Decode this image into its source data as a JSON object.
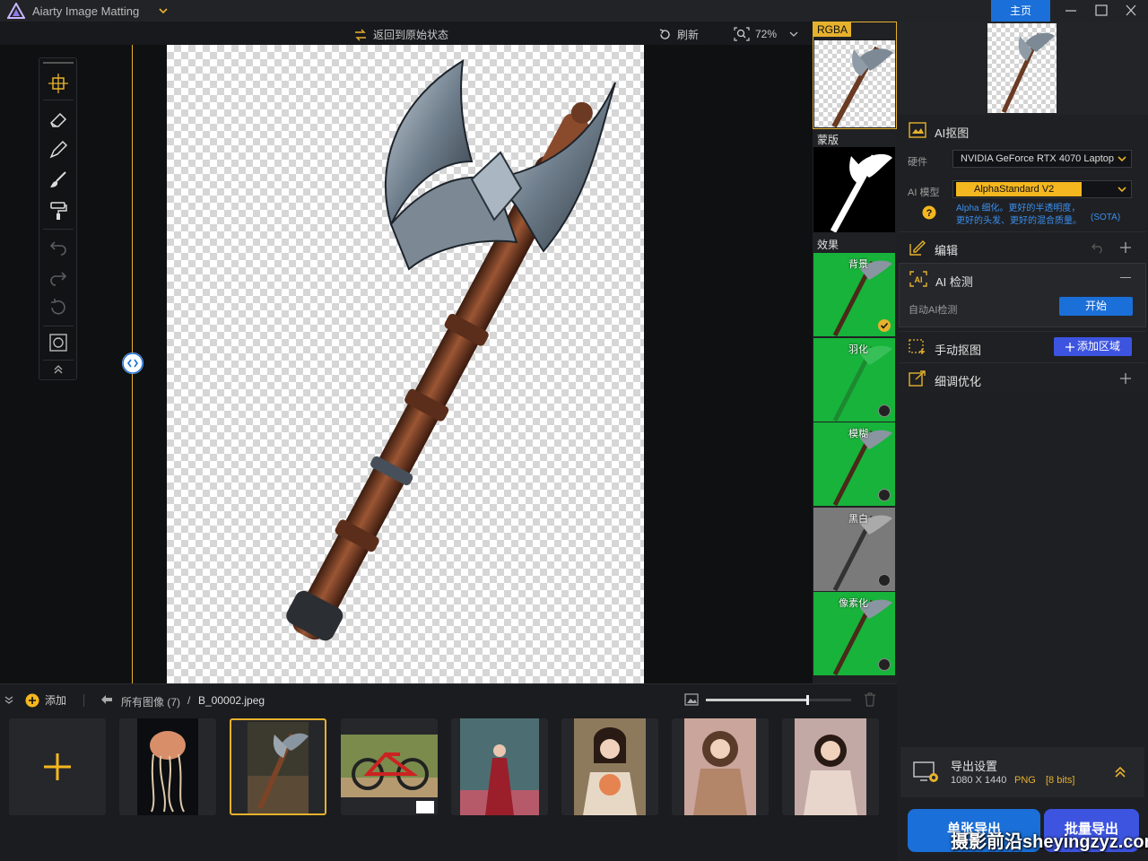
{
  "app": {
    "title": "Aiarty Image Matting",
    "home_tab": "主页"
  },
  "toolbar": {
    "reset_label": "返回到原始状态",
    "refresh_label": "刷新",
    "zoom_label": "72%"
  },
  "preview": {
    "rgba_label": "RGBA",
    "mask_label": "蒙版",
    "effects_label": "效果",
    "effects": [
      {
        "name": "背景",
        "selected": true
      },
      {
        "name": "羽化",
        "selected": false
      },
      {
        "name": "模糊",
        "selected": false
      },
      {
        "name": "黑白",
        "selected": false
      },
      {
        "name": "像素化",
        "selected": false
      }
    ]
  },
  "ai_matting": {
    "title": "AI抠图",
    "hardware_label": "硬件",
    "hardware_value": "NVIDIA GeForce RTX 4070 Laptop",
    "model_label": "AI 模型",
    "model_value": "AlphaStandard  V2",
    "model_desc_line1": "Alpha 细化。更好的半透明度，",
    "model_desc_line2": "更好的头发、更好的混合质量。",
    "model_tag": "(SOTA)"
  },
  "edit": {
    "title": "编辑"
  },
  "ai_detect": {
    "title": "AI 检测",
    "auto_label": "自动AI检测",
    "start_button": "开始"
  },
  "manual": {
    "title": "手动抠图",
    "add_area_button": "添加区域"
  },
  "refine": {
    "title": "细调优化"
  },
  "export": {
    "title": "导出设置",
    "size": "1080 X 1440",
    "format": "PNG",
    "bits": "[8 bits]",
    "single_button": "单张导出",
    "batch_button": "批量导出"
  },
  "bottom": {
    "add_label": "添加",
    "all_images": "所有图像 (7)",
    "sep": "/",
    "current_file": "B_00002.jpeg",
    "thumbnail_size": 0.7
  },
  "watermark": "摄影前沿sheyingzyz.com",
  "colors": {
    "accent": "#e6b22d",
    "blue": "#1a6fd8",
    "green": "#17b33a"
  }
}
